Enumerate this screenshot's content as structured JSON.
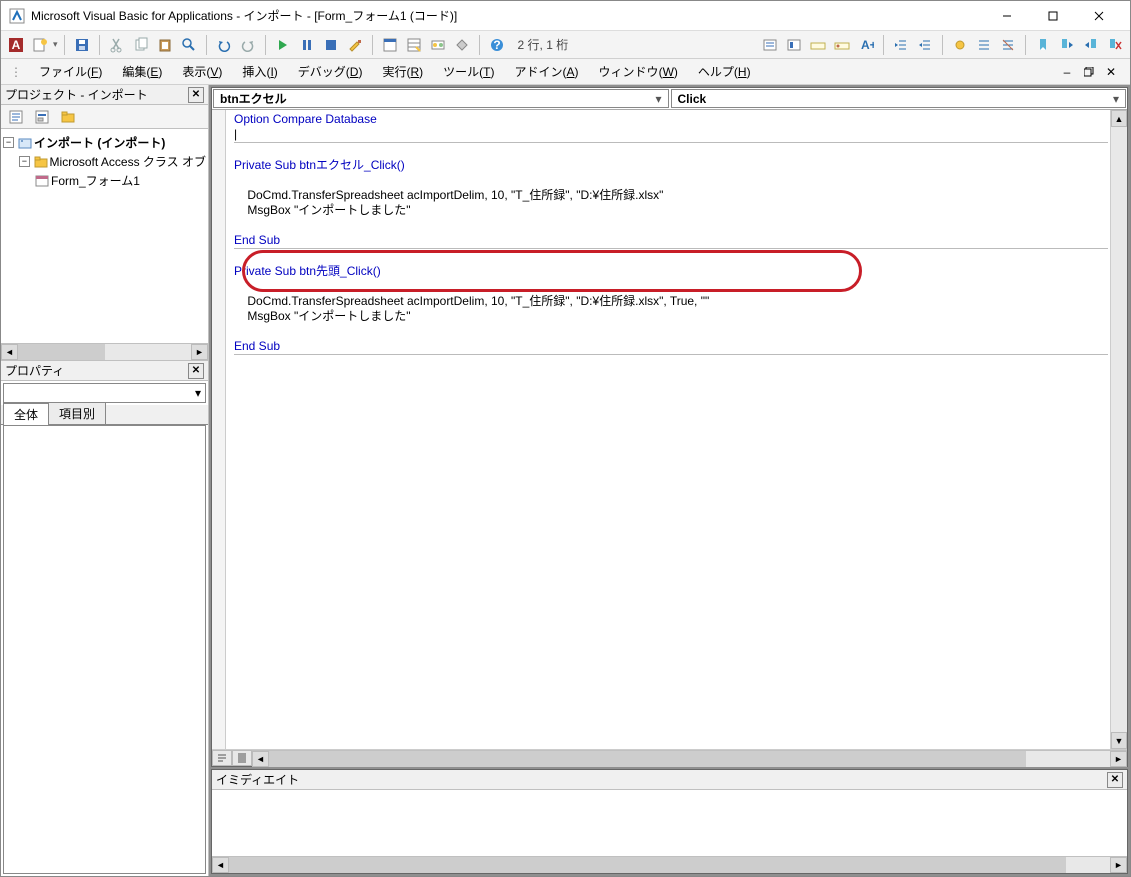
{
  "window": {
    "title": "Microsoft Visual Basic for Applications - インポート - [Form_フォーム1 (コード)]"
  },
  "toolbar": {
    "position": "2 行, 1 桁"
  },
  "menus": {
    "file": {
      "label": "ファイル",
      "key": "F"
    },
    "edit": {
      "label": "編集",
      "key": "E"
    },
    "view": {
      "label": "表示",
      "key": "V"
    },
    "insert": {
      "label": "挿入",
      "key": "I"
    },
    "debug": {
      "label": "デバッグ",
      "key": "D"
    },
    "run": {
      "label": "実行",
      "key": "R"
    },
    "tools": {
      "label": "ツール",
      "key": "T"
    },
    "addins": {
      "label": "アドイン",
      "key": "A"
    },
    "window": {
      "label": "ウィンドウ",
      "key": "W"
    },
    "help": {
      "label": "ヘルプ",
      "key": "H"
    }
  },
  "project_pane": {
    "title": "プロジェクト - インポート",
    "root": "インポート (インポート)",
    "folder": "Microsoft Access クラス オブ",
    "item": "Form_フォーム1"
  },
  "prop_pane": {
    "title": "プロパティ",
    "tab_all": "全体",
    "tab_cat": "項目別"
  },
  "code": {
    "object_combo": "btnエクセル",
    "proc_combo": "Click",
    "line1": "Option Compare Database",
    "cursor": "|",
    "sub1_open": "Private Sub btnエクセル_Click()",
    "sub1_body1": "    DoCmd.TransferSpreadsheet acImportDelim, 10, \"T_住所録\", \"D:¥住所録.xlsx\"",
    "sub1_body2": "    MsgBox \"インポートしました\"",
    "end_sub": "End Sub",
    "sub2_open": "Private Sub btn先頭_Click()",
    "sub2_body1": "    DoCmd.TransferSpreadsheet acImportDelim, 10, \"T_住所録\", \"D:¥住所録.xlsx\", True, \"\"",
    "sub2_body2": "    MsgBox \"インポートしました\""
  },
  "immediate": {
    "title": "イミディエイト"
  }
}
